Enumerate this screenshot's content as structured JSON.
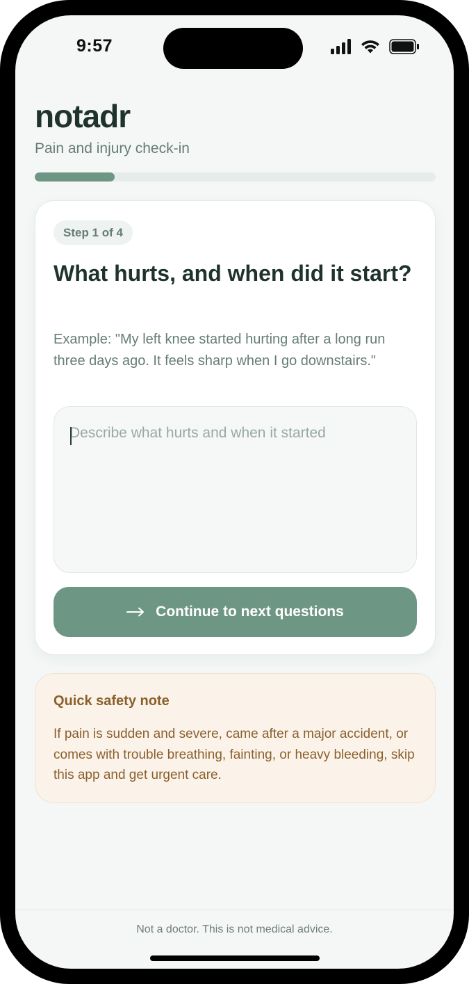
{
  "status_bar": {
    "time": "9:57",
    "icons": [
      "cellular-signal-icon",
      "wifi-icon",
      "battery-icon"
    ]
  },
  "header": {
    "brand": "notadr",
    "subtitle": "Pain and injury check-in",
    "progress": 0.2
  },
  "step_card": {
    "badge": "Step 1 of 4",
    "question": "What hurts, and when did it start?",
    "example": "Example: \"My left knee started hurting after a long run three days ago. It feels sharp when I go downstairs.\"",
    "input_value": "",
    "input_placeholder": "Describe what hurts and when it started",
    "continue_label": "Continue to next questions",
    "continue_icon": "arrow-right-icon"
  },
  "safety_note": {
    "title": "Quick safety note",
    "body": "If pain is sudden and severe, came after a major accident, or comes with trouble breathing, fainting, or heavy bleeding, skip this app and get urgent care."
  },
  "footer": {
    "disclaimer": "Not a doctor. This is not medical advice."
  },
  "colors": {
    "accent": "#6d9685",
    "text_dark": "#1f332c",
    "text_muted": "#667d74",
    "warning_bg": "#fbf3e9",
    "warning_text": "#8a5f2c"
  }
}
